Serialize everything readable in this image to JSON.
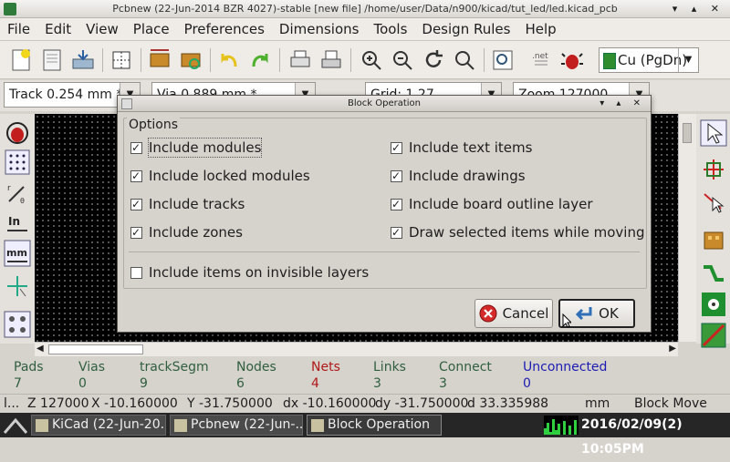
{
  "window": {
    "title": "Pcbnew (22-Jun-2014 BZR 4027)-stable  [new file] /home/user/Data/n900/kicad/tut_led/led.kicad_pcb",
    "controls": "▾ ▴ ✕"
  },
  "menu": [
    "File",
    "Edit",
    "View",
    "Place",
    "Preferences",
    "Dimensions",
    "Tools",
    "Design Rules",
    "Help"
  ],
  "toolbar": {
    "layer": "Cu (PgDn)",
    "layer_color": "#2e8b2e"
  },
  "options": {
    "track": "Track 0.254 mm *",
    "via": "Via 0.889 mm *",
    "grid": "Grid: 1.27",
    "zoom": "Zoom 127000"
  },
  "dialog": {
    "title": "Block Operation",
    "group_label": "Options",
    "checkboxes": [
      {
        "label": "Include modules",
        "checked": true
      },
      {
        "label": "Include text items",
        "checked": true
      },
      {
        "label": "Include locked modules",
        "checked": true
      },
      {
        "label": "Include drawings",
        "checked": true
      },
      {
        "label": "Include tracks",
        "checked": true
      },
      {
        "label": "Include board outline layer",
        "checked": true
      },
      {
        "label": "Include zones",
        "checked": true
      },
      {
        "label": "Draw selected items while moving",
        "checked": true
      },
      {
        "label": "Include items on invisible layers",
        "checked": false
      }
    ],
    "cancel_label": "Cancel",
    "ok_label": "OK"
  },
  "message_panel": [
    {
      "label": "Pads",
      "value": "7",
      "label_color": "#2f5f3f",
      "value_color": "#2f5f3f"
    },
    {
      "label": "Vias",
      "value": "0",
      "label_color": "#2f5f3f",
      "value_color": "#2f5f3f"
    },
    {
      "label": "trackSegm",
      "value": "9",
      "label_color": "#2f5f3f",
      "value_color": "#2f5f3f"
    },
    {
      "label": "Nodes",
      "value": "6",
      "label_color": "#2f5f3f",
      "value_color": "#2f5f3f"
    },
    {
      "label": "Nets",
      "value": "4",
      "label_color": "#b01818",
      "value_color": "#b01818"
    },
    {
      "label": "Links",
      "value": "3",
      "label_color": "#2f5f3f",
      "value_color": "#2f5f3f"
    },
    {
      "label": "Connect",
      "value": "3",
      "label_color": "#2f5f3f",
      "value_color": "#2f5f3f"
    },
    {
      "label": "Unconnected",
      "value": "0",
      "label_color": "#1c1cb4",
      "value_color": "#1c1cb4"
    }
  ],
  "statusbar": {
    "prefix": "l...",
    "zoom": "Z 127000",
    "x": "X -10.160000",
    "y": "Y -31.750000",
    "dx": "dx -10.160000",
    "dy": "dy -31.750000",
    "d": "d 33.335988",
    "units": "mm",
    "mode": "Block Move"
  },
  "taskbar": {
    "tasks": [
      "KiCad (22-Jun-20...",
      "Pcbnew (22-Jun-...",
      "Block Operation"
    ],
    "clock": "2016/02/09(2) 10:05PM"
  }
}
